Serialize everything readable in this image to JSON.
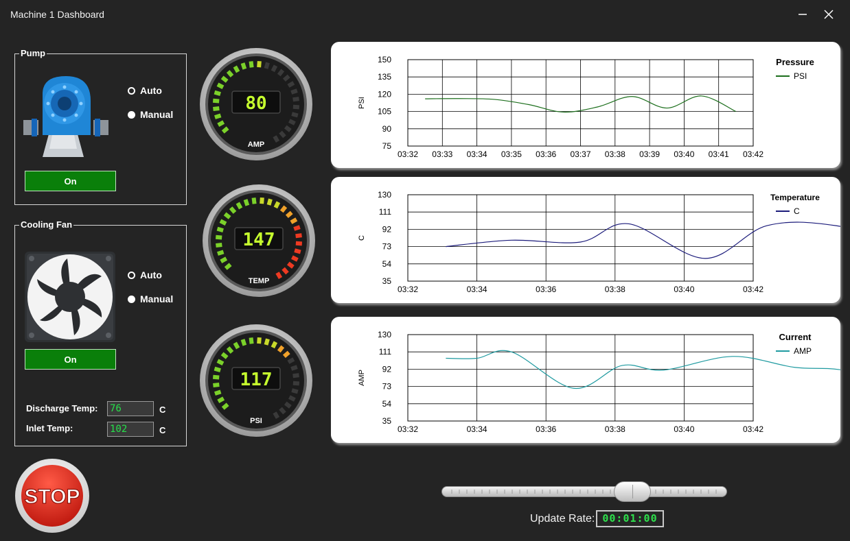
{
  "window": {
    "title": "Machine 1 Dashboard",
    "minimize_icon": "minimize-icon",
    "close_icon": "close-icon"
  },
  "pump": {
    "group_title": "Pump",
    "image_icon": "centrifugal-pump-icon",
    "mode_options": [
      "Auto",
      "Manual"
    ],
    "selected_mode": "Manual",
    "button_label": "On"
  },
  "cooling_fan": {
    "group_title": "Cooling Fan",
    "image_icon": "fan-icon",
    "mode_options": [
      "Auto",
      "Manual"
    ],
    "selected_mode": "Manual",
    "button_label": "On",
    "discharge_temp_label": "Discharge Temp:",
    "discharge_temp_value": "76",
    "discharge_temp_unit": "C",
    "inlet_temp_label": "Inlet Temp:",
    "inlet_temp_value": "102",
    "inlet_temp_unit": "C"
  },
  "stop_button": {
    "label": "STOP",
    "color": "#d92a1c"
  },
  "gauges": [
    {
      "label": "AMP",
      "value": "80",
      "level": 0.5
    },
    {
      "label": "TEMP",
      "value": "147",
      "level": 1.0
    },
    {
      "label": "PSI",
      "value": "117",
      "level": 0.67
    }
  ],
  "charts": [
    {
      "type": "line",
      "title": "Pressure",
      "ylabel": "PSI",
      "yticks": [
        75,
        90,
        105,
        120,
        135,
        150
      ],
      "ylim": [
        75,
        150
      ],
      "xticks": [
        "03:32",
        "03:33",
        "03:34",
        "03:35",
        "03:36",
        "03:37",
        "03:38",
        "03:39",
        "03:40",
        "03:41",
        "03:42"
      ],
      "series": [
        {
          "name": "PSI",
          "color": "#1b6e1b",
          "points": [
            [
              0.5,
              116
            ],
            [
              1.5,
              116.2
            ],
            [
              2.5,
              115.5
            ],
            [
              3.5,
              111
            ],
            [
              4.5,
              104.5
            ],
            [
              5.5,
              109
            ],
            [
              6.5,
              118
            ],
            [
              7.5,
              108
            ],
            [
              8.5,
              118.5
            ],
            [
              9.5,
              105
            ]
          ]
        }
      ]
    },
    {
      "type": "line",
      "title": "Temperature",
      "ylabel": "C",
      "yticks": [
        35,
        54,
        73,
        92,
        111,
        130
      ],
      "ylim": [
        35,
        130
      ],
      "xticks": [
        "03:32",
        "03:34",
        "03:36",
        "03:38",
        "03:40",
        "03:42"
      ],
      "series": [
        {
          "name": "C",
          "color": "#1a1a7a",
          "points": [
            [
              0.55,
              73
            ],
            [
              1.5,
              80
            ],
            [
              2.5,
              78
            ],
            [
              3.2,
              98
            ],
            [
              4.3,
              60
            ],
            [
              5.2,
              96
            ],
            [
              6.2,
              96
            ],
            [
              7.5,
              71
            ]
          ]
        }
      ]
    },
    {
      "type": "line",
      "title": "Current",
      "ylabel": "AMP",
      "yticks": [
        35,
        54,
        73,
        92,
        111,
        130
      ],
      "ylim": [
        35,
        130
      ],
      "xticks": [
        "03:32",
        "03:34",
        "03:36",
        "03:38",
        "03:40",
        "03:42"
      ],
      "series": [
        {
          "name": "AMP",
          "color": "#1e9aa0",
          "points": [
            [
              0.55,
              104
            ],
            [
              1.0,
              104
            ],
            [
              1.5,
              111
            ],
            [
              2.4,
              71
            ],
            [
              3.1,
              96
            ],
            [
              3.7,
              91
            ],
            [
              4.7,
              106
            ],
            [
              5.6,
              94
            ],
            [
              6.3,
              91
            ],
            [
              7.5,
              73
            ]
          ]
        }
      ]
    }
  ],
  "update_rate": {
    "label": "Update Rate:",
    "value": "00:01:00",
    "slider_level": 0.6
  }
}
